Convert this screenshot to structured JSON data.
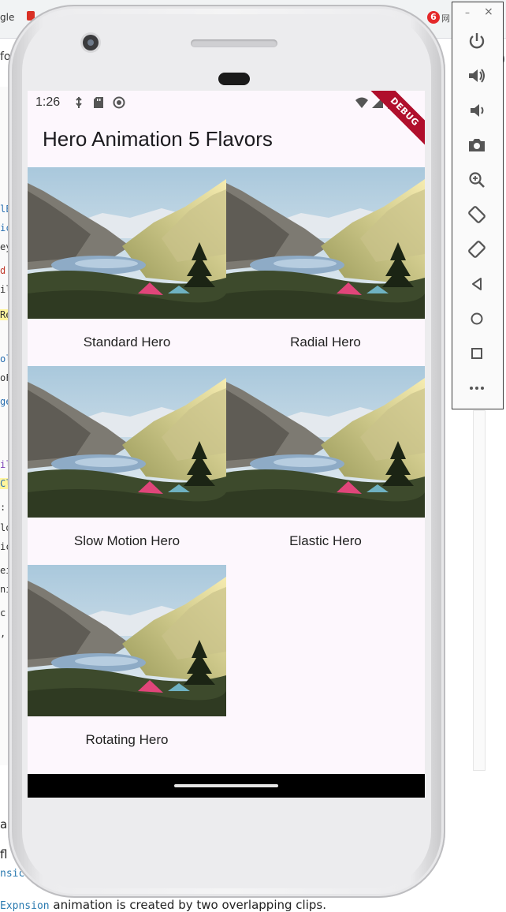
{
  "background": {
    "browser_tab_text": "gle",
    "right_badge": "6",
    "right_text": "网",
    "address_fragment": "fo",
    "code_fragments": [
      {
        "text": "lE",
        "color": "#2a6fb0"
      },
      {
        "text": "ic",
        "color": "#2a6fb0"
      },
      {
        "text": "ey",
        "color": "#333333"
      },
      {
        "text": "d",
        "color": "#c0392b"
      },
      {
        "text": "il",
        "color": "#333333"
      },
      {
        "text": "Re",
        "color": "#333333"
      },
      {
        "text": "ol",
        "color": "#2a6fb0"
      },
      {
        "text": "oF",
        "color": "#333333"
      },
      {
        "text": "ge",
        "color": "#2a6fb0"
      },
      {
        "text": "il",
        "color": "#7b3fb5"
      },
      {
        "text": "Cl",
        "color": "#2a6fb0"
      },
      {
        "text": ":",
        "color": "#333333"
      },
      {
        "text": "lo",
        "color": "#333333"
      },
      {
        "text": "ic",
        "color": "#333333"
      },
      {
        "text": "ei",
        "color": "#333333"
      },
      {
        "text": "ni",
        "color": "#333333"
      },
      {
        "text": " c",
        "color": "#333333"
      },
      {
        "text": ",",
        "color": "#333333"
      }
    ],
    "bottom_a": "a",
    "bottom_f": "fl",
    "bottom_x": "nsic",
    "bottom_sentence_code": "Expnsion",
    "bottom_sentence_text": " animation is created by two overlapping clips."
  },
  "status_bar": {
    "time": "1:26",
    "left_icons": [
      "usb-debug-icon",
      "sd-card-icon",
      "sync-icon"
    ],
    "right_icons": [
      "wifi-icon",
      "signal-icon",
      "battery-icon"
    ]
  },
  "app_bar": {
    "title": "Hero Animation 5 Flavors"
  },
  "debug_banner": "DEBUG",
  "grid": {
    "items": [
      {
        "label": "Standard Hero"
      },
      {
        "label": "Radial Hero"
      },
      {
        "label": "Slow Motion Hero"
      },
      {
        "label": "Elastic Hero"
      },
      {
        "label": "Rotating Hero"
      }
    ]
  },
  "emulator_toolbar": {
    "minimize": "–",
    "close": "×",
    "buttons": [
      "power-icon",
      "volume-up-icon",
      "volume-down-icon",
      "camera-icon",
      "zoom-icon",
      "rotate-left-icon",
      "rotate-right-icon",
      "back-icon",
      "home-icon",
      "overview-icon",
      "more-icon"
    ]
  }
}
